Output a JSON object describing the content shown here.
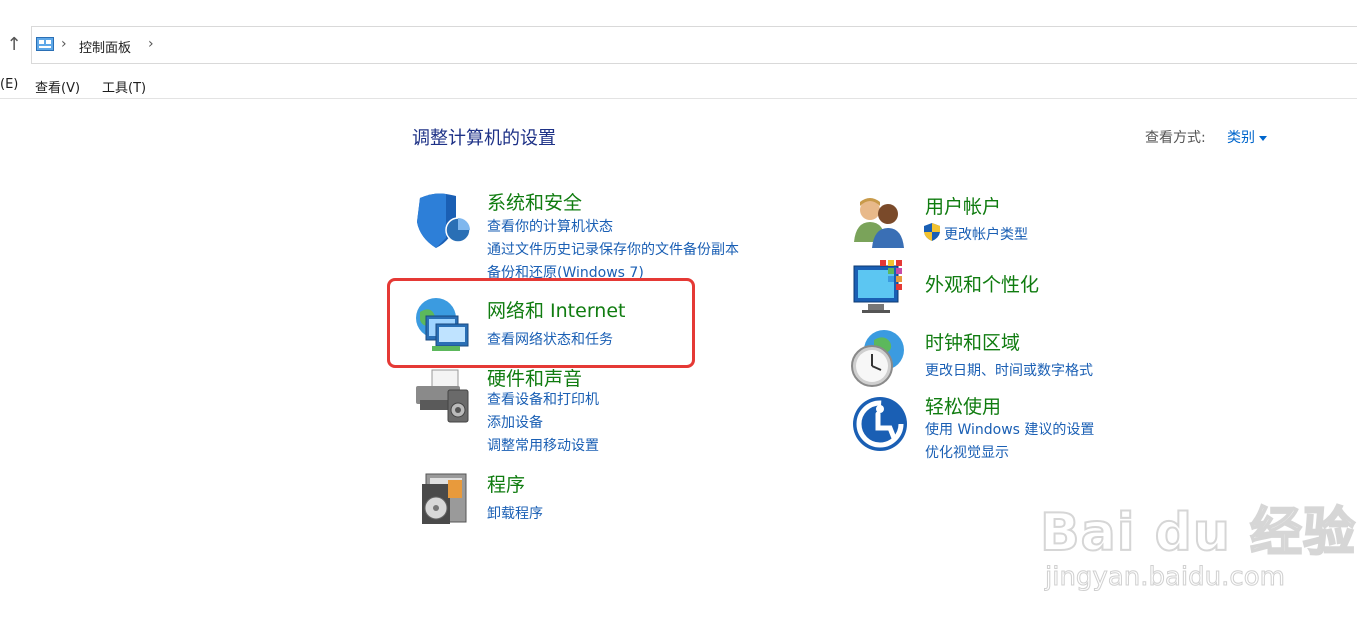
{
  "address_bar": {
    "breadcrumb": "控制面板"
  },
  "menu": {
    "edit": "(E)",
    "view": "查看(V)",
    "tools": "工具(T)"
  },
  "header": {
    "title": "调整计算机的设置",
    "view_by_label": "查看方式:",
    "view_by_value": "类别"
  },
  "categories": {
    "system": {
      "title": "系统和安全",
      "links": [
        "查看你的计算机状态",
        "通过文件历史记录保存你的文件备份副本",
        "备份和还原(Windows 7)"
      ]
    },
    "network": {
      "title": "网络和 Internet",
      "links": [
        "查看网络状态和任务"
      ]
    },
    "hardware": {
      "title": "硬件和声音",
      "links": [
        "查看设备和打印机",
        "添加设备",
        "调整常用移动设置"
      ]
    },
    "programs": {
      "title": "程序",
      "links": [
        "卸载程序"
      ]
    },
    "users": {
      "title": "用户帐户",
      "links": [
        "更改帐户类型"
      ]
    },
    "appearance": {
      "title": "外观和个性化",
      "links": []
    },
    "clock": {
      "title": "时钟和区域",
      "links": [
        "更改日期、时间或数字格式"
      ]
    },
    "ease": {
      "title": "轻松使用",
      "links": [
        "使用 Windows 建议的设置",
        "优化视觉显示"
      ]
    }
  },
  "watermark": {
    "logo": "Bai du 经验",
    "url": "jingyan.baidu.com"
  },
  "colors": {
    "category_title": "#107c10",
    "link": "#1a5fb4",
    "page_title": "#1e3287",
    "highlight": "#e53935"
  }
}
